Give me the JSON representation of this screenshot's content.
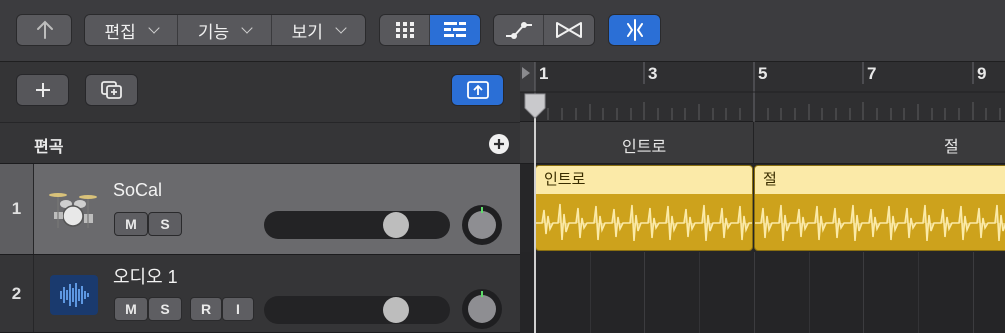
{
  "toolbar": {
    "back_icon": "up-arrow-icon",
    "menus": [
      {
        "label": "편집"
      },
      {
        "label": "기능"
      },
      {
        "label": "보기"
      }
    ],
    "view_buttons": [
      "grid-view-icon",
      "list-view-icon"
    ],
    "automation_buttons": [
      "automation-curve-icon",
      "flex-time-icon"
    ],
    "catch_button": "snap-scissors-icon",
    "accent_color": "#2b6fd6"
  },
  "track_list": {
    "add_track_icon": "plus-icon",
    "duplicate_track_icon": "duplicate-icon",
    "upload_icon": "export-icon",
    "header_label": "편곡",
    "header_add_icon": "plus-circle-icon"
  },
  "tracks": [
    {
      "number": "1",
      "name": "SoCal",
      "icon": "drum-kit-icon",
      "buttons": [
        "M",
        "S"
      ],
      "volume": 0.68
    },
    {
      "number": "2",
      "name": "오디오 1",
      "icon": "audio-waveform-icon",
      "buttons": [
        "M",
        "S",
        "R",
        "I"
      ],
      "volume": 0.68
    }
  ],
  "ruler": {
    "bars": [
      "1",
      "3",
      "5",
      "7",
      "9"
    ]
  },
  "arrangement": {
    "markers": [
      {
        "label": "인트로"
      },
      {
        "label": "절"
      }
    ]
  },
  "regions": [
    {
      "title": "인트로",
      "color": "#cda21c"
    },
    {
      "title": "절",
      "color": "#cda21c"
    }
  ]
}
